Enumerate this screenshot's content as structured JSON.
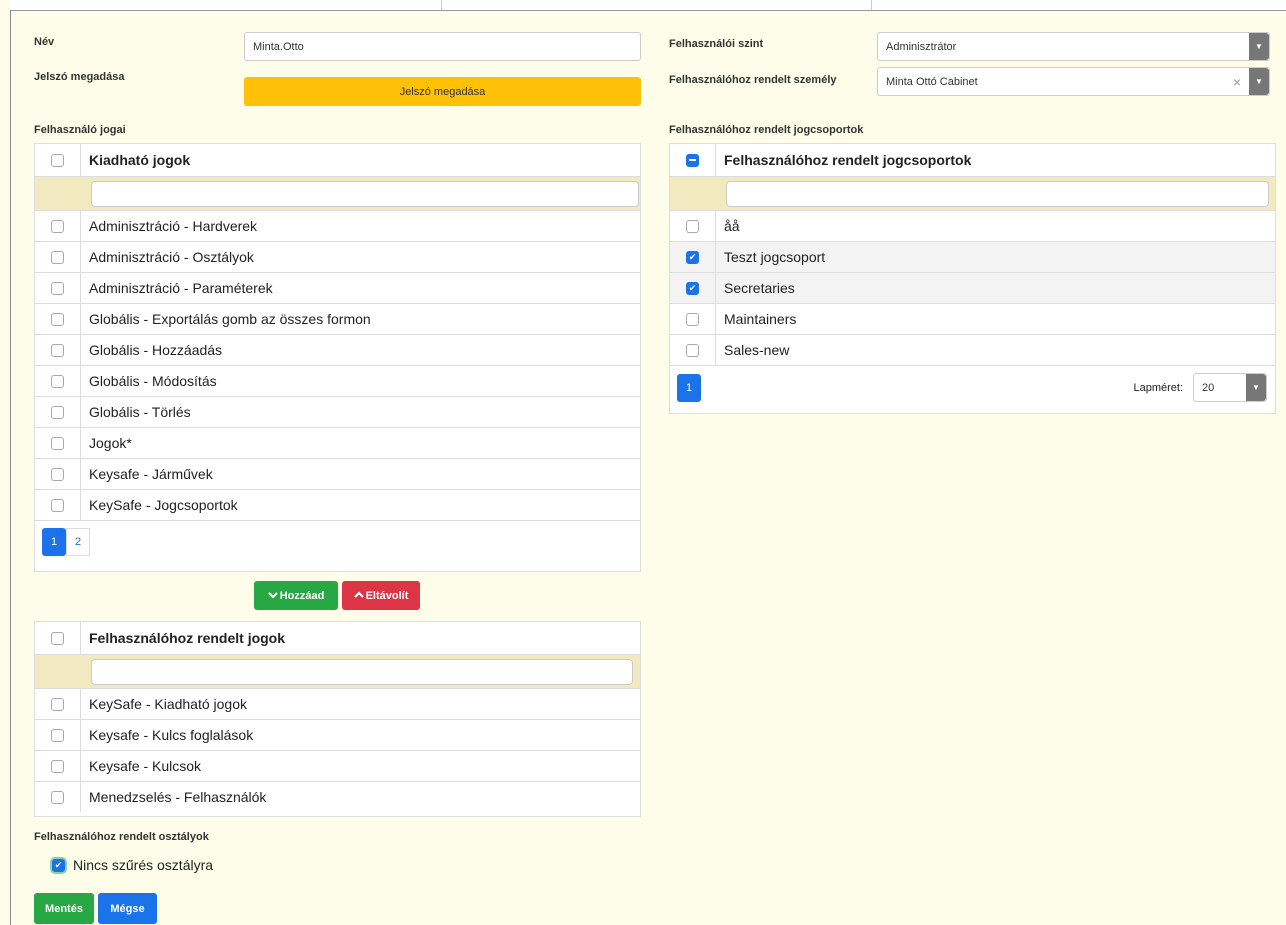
{
  "form": {
    "name_label": "Név",
    "name_value": "Minta.Otto",
    "password_label": "Jelszó megadása",
    "password_button": "Jelszó megadása",
    "rights_label": "Felhasználó jogai",
    "user_level_label": "Felhasználói szint",
    "user_level_value": "Adminisztrátor",
    "person_label": "Felhasználóhoz rendelt személy",
    "person_value": "Minta Ottó Cabinet",
    "groups_label": "Felhasználóhoz rendelt jogcsoportok",
    "departments_label": "Felhasználóhoz rendelt osztályok",
    "no_filter_label": "Nincs szűrés osztályra"
  },
  "available_rights": {
    "header": "Kiadható jogok",
    "items": [
      "Adminisztráció - Hardverek",
      "Adminisztráció - Osztályok",
      "Adminisztráció - Paraméterek",
      "Globális - Exportálás gomb az összes formon",
      "Globális - Hozzáadás",
      "Globális - Módosítás",
      "Globális - Törlés",
      "Jogok*",
      "Keysafe - Járművek",
      "KeySafe - Jogcsoportok"
    ],
    "pages": [
      "1",
      "2"
    ]
  },
  "actions": {
    "add_label": "Hozzáad",
    "remove_label": "Eltávolít"
  },
  "assigned_rights": {
    "header": "Felhasználóhoz rendelt jogok",
    "items": [
      "KeySafe - Kiadható jogok",
      "Keysafe - Kulcs foglalások",
      "Keysafe - Kulcsok",
      "Menedzselés - Felhasználók"
    ]
  },
  "groups": {
    "header": "Felhasználóhoz rendelt jogcsoportok",
    "items": [
      "åå",
      "Teszt jogcsoport",
      "Secretaries",
      "Maintainers",
      "Sales-new"
    ],
    "checked": [
      false,
      true,
      true,
      false,
      false
    ],
    "page": "1",
    "page_size_label": "Lapméret:",
    "page_size": "20"
  },
  "buttons": {
    "save": "Mentés",
    "cancel": "Mégse"
  },
  "colors": {
    "background": "#fdfdea",
    "primary": "#1a73e8",
    "success": "#28a745",
    "danger": "#dc3545",
    "warning": "#ffc107"
  }
}
